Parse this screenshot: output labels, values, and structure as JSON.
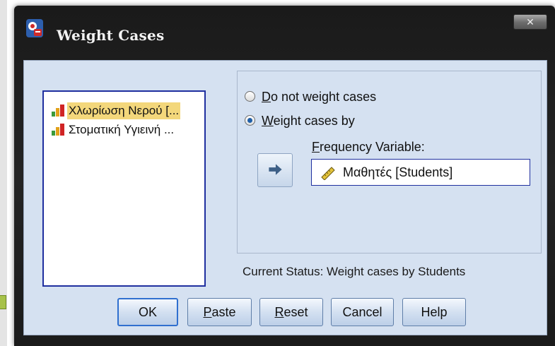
{
  "window": {
    "title": "Weight Cases",
    "close_glyph": "✕",
    "icon": "spss-app-icon"
  },
  "variables": [
    {
      "label": "Χλωρίωση Νερού [...",
      "icon": "nominal-bar-chart-icon",
      "selected": true
    },
    {
      "label": "Στοματική Υγιεινή ...",
      "icon": "nominal-bar-chart-icon",
      "selected": false
    }
  ],
  "options": {
    "no_weight": {
      "mnemonic": "D",
      "rest": "o not weight cases",
      "checked": false
    },
    "weight_by": {
      "mnemonic": "W",
      "rest": "eight cases by",
      "checked": true
    }
  },
  "frequency": {
    "label_mnemonic": "F",
    "label_rest": "requency Variable:",
    "value": "Μαθητές [Students]",
    "icon": "scale-ruler-icon"
  },
  "move_button": {
    "icon": "move-right-arrow-icon"
  },
  "status": "Current Status: Weight cases by Students",
  "buttons": {
    "ok": "OK",
    "paste": {
      "mnemonic": "P",
      "rest": "aste"
    },
    "reset": {
      "mnemonic": "R",
      "rest": "eset"
    },
    "cancel": "Cancel",
    "help": "Help"
  },
  "colors": {
    "dialog_background": "#d5e1f1",
    "selection_highlight": "#f3d77b",
    "list_border": "#1f2f9f",
    "window_frame": "#1f1f1f"
  }
}
